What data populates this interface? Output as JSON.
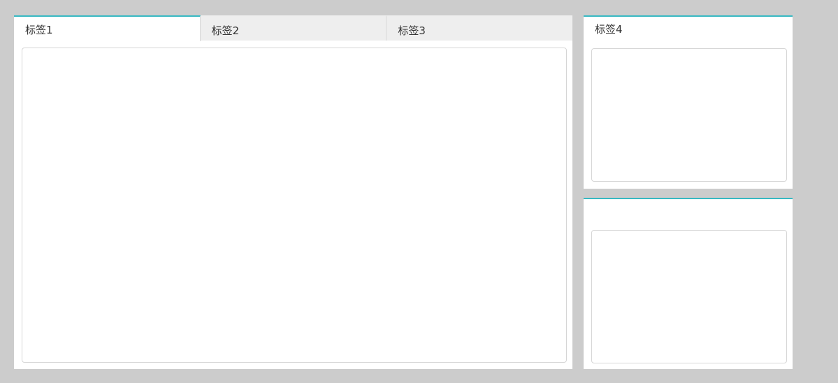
{
  "main_panel": {
    "tabs": [
      {
        "label": "标签1",
        "active": true
      },
      {
        "label": "标签2",
        "active": false
      },
      {
        "label": "标签3",
        "active": false
      }
    ]
  },
  "side_panel_top": {
    "tab_label": "标签4"
  },
  "side_panel_bottom": {
    "tab_label": ""
  },
  "colors": {
    "background": "#cccccc",
    "accent": "#37b8c2",
    "inactive_tab": "#eeeeee",
    "panel": "#ffffff"
  }
}
